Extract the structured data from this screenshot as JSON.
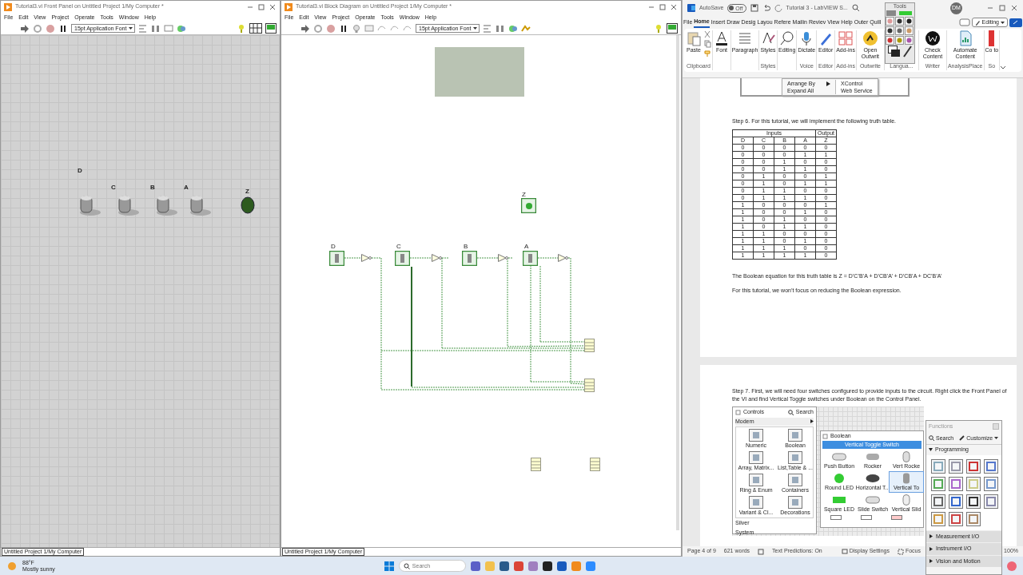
{
  "front_panel": {
    "title": "Tutorial3.vi Front Panel on Untitled Project 1/My Computer *",
    "menu": [
      "File",
      "Edit",
      "View",
      "Project",
      "Operate",
      "Tools",
      "Window",
      "Help"
    ],
    "font": "15pt Application Font",
    "switches": [
      {
        "label": "D",
        "on": false
      },
      {
        "label": "C",
        "on": false
      },
      {
        "label": "B",
        "on": false
      },
      {
        "label": "A",
        "on": false
      }
    ],
    "led": {
      "label": "Z",
      "on": false
    },
    "status": "Untitled Project 1/My Computer"
  },
  "block_diagram": {
    "title": "Tutorial3.vi Block Diagram on Untitled Project 1/My Computer *",
    "menu": [
      "File",
      "Edit",
      "View",
      "Project",
      "Operate",
      "Tools",
      "Window",
      "Help"
    ],
    "font": "15pt Application Font",
    "terminals": [
      {
        "label": "D"
      },
      {
        "label": "C"
      },
      {
        "label": "B"
      },
      {
        "label": "A"
      }
    ],
    "indicator": {
      "label": "Z"
    },
    "status": "Untitled Project 1/My Computer"
  },
  "word": {
    "autosave": "AutoSave",
    "autosave_state": "Off",
    "doc_title": "Tutorial 3 - LabVIEW S...",
    "user_initials": "DM",
    "tabs": [
      {
        "label": "File",
        "selected": false
      },
      {
        "label": "Home",
        "selected": true
      },
      {
        "label": "Insert",
        "selected": false
      },
      {
        "label": "Draw",
        "selected": false
      },
      {
        "label": "Desig",
        "selected": false
      },
      {
        "label": "Layou",
        "selected": false
      },
      {
        "label": "Refere",
        "selected": false
      },
      {
        "label": "Mailin",
        "selected": false
      },
      {
        "label": "Reviev",
        "selected": false
      },
      {
        "label": "View",
        "selected": false
      },
      {
        "label": "Help",
        "selected": false
      },
      {
        "label": "Outer",
        "selected": false
      },
      {
        "label": "Quill",
        "selected": false
      }
    ],
    "mode": "Editing",
    "ribbon": [
      {
        "button": "Paste",
        "group": "Clipboard"
      },
      {
        "button": "Font"
      },
      {
        "button": "Paragraph"
      },
      {
        "button": "Styles",
        "group": "Styles"
      },
      {
        "button": "Editing"
      },
      {
        "button": "Dictate",
        "group": "Voice"
      },
      {
        "button": "Editor",
        "group": "Editor"
      },
      {
        "button": "Add-ins",
        "group": "Add-ins"
      },
      {
        "button": "Open Outwrit",
        "group": "Outwrite"
      },
      {
        "group": "Langua..."
      },
      {
        "button": "Check Content",
        "group": "Writer"
      },
      {
        "button": "Automate Content",
        "group": "AnalysisPlace"
      },
      {
        "button": "Co to",
        "group": "So"
      }
    ],
    "context_menu": {
      "items": [
        {
          "label": "Arrange By",
          "submenu": true
        },
        {
          "label": "Expand All",
          "submenu": false
        }
      ],
      "submenu": [
        "XControl",
        "Web Service"
      ]
    },
    "step6": "Step 6.   For this tutorial, we will implement the following truth table.",
    "truth_table": {
      "groups": [
        "Inputs",
        "Output"
      ],
      "columns": [
        "D",
        "C",
        "B",
        "A",
        "Z"
      ],
      "rows": [
        [
          "0",
          "0",
          "0",
          "0",
          "0"
        ],
        [
          "0",
          "0",
          "0",
          "1",
          "1"
        ],
        [
          "0",
          "0",
          "1",
          "0",
          "0"
        ],
        [
          "0",
          "0",
          "1",
          "1",
          "0"
        ],
        [
          "0",
          "1",
          "0",
          "0",
          "1"
        ],
        [
          "0",
          "1",
          "0",
          "1",
          "1"
        ],
        [
          "0",
          "1",
          "1",
          "0",
          "0"
        ],
        [
          "0",
          "1",
          "1",
          "1",
          "0"
        ],
        [
          "1",
          "0",
          "0",
          "0",
          "1"
        ],
        [
          "1",
          "0",
          "0",
          "1",
          "0"
        ],
        [
          "1",
          "0",
          "1",
          "0",
          "0"
        ],
        [
          "1",
          "0",
          "1",
          "1",
          "0"
        ],
        [
          "1",
          "1",
          "0",
          "0",
          "0"
        ],
        [
          "1",
          "1",
          "0",
          "1",
          "0"
        ],
        [
          "1",
          "1",
          "1",
          "0",
          "0"
        ],
        [
          "1",
          "1",
          "1",
          "1",
          "0"
        ]
      ]
    },
    "equation": "The Boolean equation for this truth table is Z = D’C’B’A + D’CB’A’ + D’CB’A + DC’B’A’",
    "note": "For this tutorial, we won’t focus on reducing the Boolean expression.",
    "step7": "Step 7.  First, we will need four switches configured to provide inputs to the circuit.  Right click the Front Panel of the VI and find Vertical Toggle switches under Boolean on the Control Panel.",
    "figure": {
      "controls_palette": {
        "title": "Controls",
        "search": "Search",
        "category": "Modern",
        "items": [
          "Numeric",
          "Boolean",
          "Array, Matrix...",
          "List,Table & ...",
          "Ring & Enum",
          "Containers",
          "Variant & Cl...",
          "Decorations"
        ],
        "sections": [
          "Silver",
          "System"
        ]
      },
      "boolean_palette": {
        "title": "Boolean",
        "hovered": "Vertical Toggle Switch",
        "items": [
          {
            "label": "Push Button",
            "selected": false
          },
          {
            "label": "Rocker",
            "selected": false
          },
          {
            "label": "Vert Rocke",
            "selected": false
          },
          {
            "label": "Round LED",
            "selected": false
          },
          {
            "label": "Horizontal T...",
            "selected": false
          },
          {
            "label": "Vertical To",
            "selected": true
          },
          {
            "label": "Square LED",
            "selected": false
          },
          {
            "label": "Slide Switch",
            "selected": false
          },
          {
            "label": "Vertical Slid",
            "selected": false
          }
        ]
      }
    },
    "status_bar": {
      "page": "Page 4 of 9",
      "words": "621 words",
      "predictions": "Text Predictions: On",
      "display": "Display Settings",
      "focus": "Focus",
      "zoom": "100%"
    }
  },
  "tools_palette": {
    "title": "Tools"
  },
  "functions_palette": {
    "title": "Functions",
    "search": "Search",
    "customize": "Customize",
    "category": "Programming",
    "sections": [
      "Measurement I/O",
      "Instrument I/O",
      "Vision and Motion"
    ]
  },
  "taskbar": {
    "temperature": "88°F",
    "weather": "Mostly sunny",
    "search_placeholder": "Search"
  }
}
